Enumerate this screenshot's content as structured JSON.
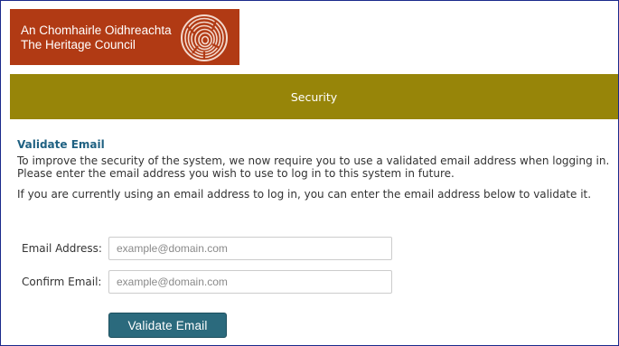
{
  "logo": {
    "line1": "An Chomhairle Oidhreachta",
    "line2": "The Heritage Council",
    "icon": "fingerprint-icon",
    "background": "#b13a14"
  },
  "banner": {
    "title": "Security",
    "background": "#978509"
  },
  "main": {
    "heading": "Validate Email",
    "paragraph1_line1": "To improve the security of the system, we now require you to use a validated email address when logging in.",
    "paragraph1_line2": "Please enter the email address you wish to use to log in to this system in future.",
    "paragraph2": "If you are currently using an email address to log in, you can enter the email address below to validate it."
  },
  "form": {
    "email": {
      "label": "Email Address:",
      "value": "",
      "placeholder": "example@domain.com"
    },
    "confirm": {
      "label": "Confirm Email:",
      "value": "",
      "placeholder": "example@domain.com"
    },
    "submit_label": "Validate Email"
  },
  "colors": {
    "heading": "#1f6182",
    "button": "#2b6a7d",
    "frame_border": "#1a2a8c"
  }
}
